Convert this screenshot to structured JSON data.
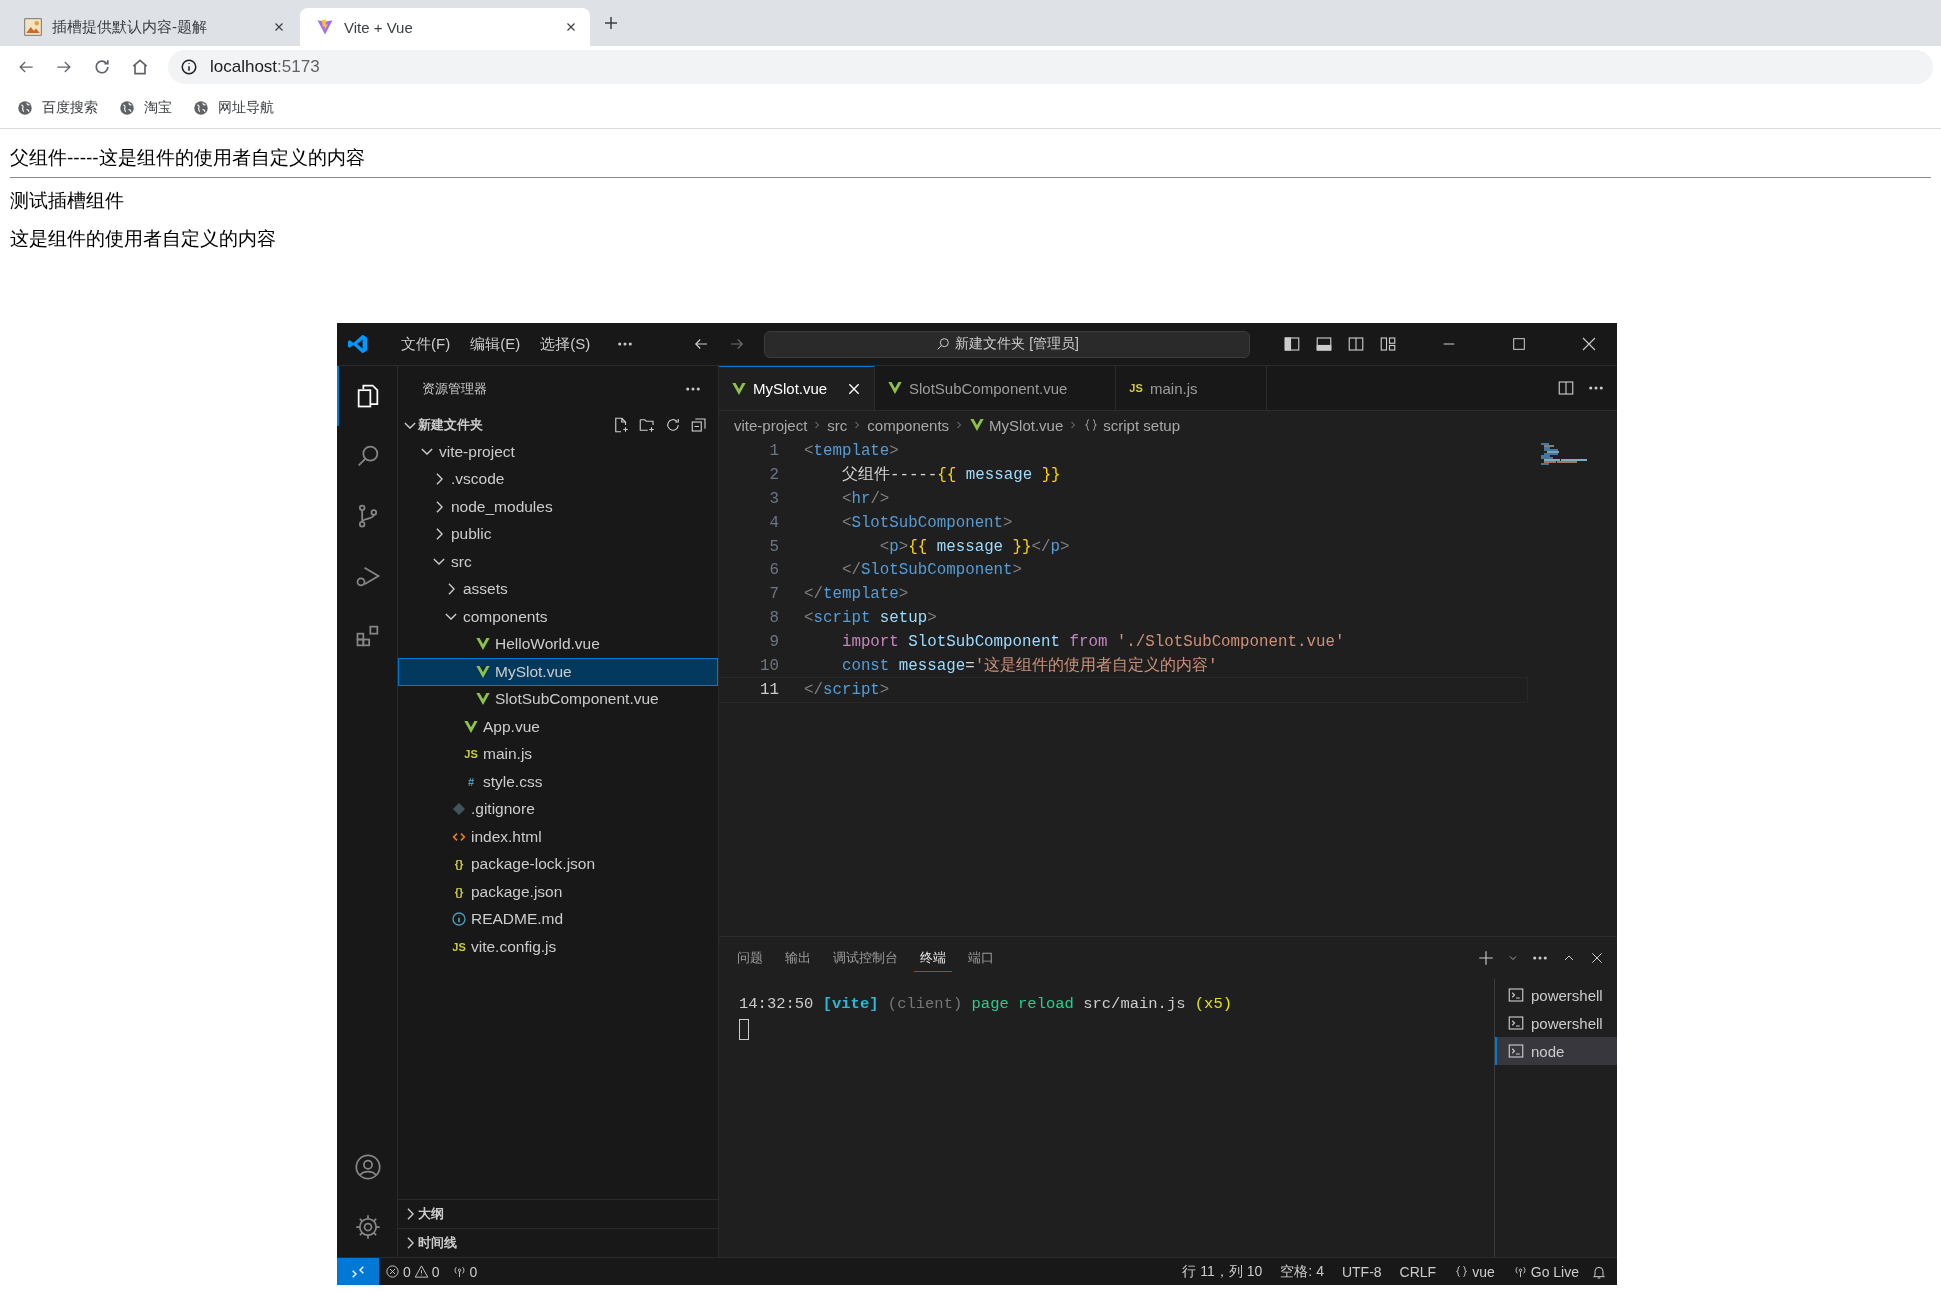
{
  "browser": {
    "tabs": [
      {
        "title": "插槽提供默认内容-题解",
        "selected": false
      },
      {
        "title": "Vite + Vue",
        "selected": true
      }
    ],
    "address": {
      "host": "localhost",
      "port": ":5173"
    },
    "bookmarks": [
      "百度搜索",
      "淘宝",
      "网址导航"
    ]
  },
  "page": {
    "lines": [
      {
        "kind": "text",
        "text": "父组件-----这是组件的使用者自定义的内容"
      },
      {
        "kind": "rule"
      },
      {
        "kind": "text",
        "text": "测试插槽组件"
      },
      {
        "kind": "text",
        "text": "这是组件的使用者自定义的内容"
      }
    ]
  },
  "vscode": {
    "menus": [
      "文件(F)",
      "编辑(E)",
      "选择(S)"
    ],
    "command_center": "新建文件夹 [管理员]",
    "activity": [
      {
        "kind": "explorer",
        "selected": true
      },
      {
        "kind": "search",
        "selected": false
      },
      {
        "kind": "scm",
        "selected": false
      },
      {
        "kind": "debug",
        "selected": false
      },
      {
        "kind": "extensions",
        "selected": false
      }
    ],
    "sidebar": {
      "title": "资源管理器",
      "root": {
        "label": "新建文件夹",
        "expanded": true
      },
      "tree": [
        {
          "label": "vite-project",
          "kind": "folder",
          "expanded": true,
          "selected": false,
          "children": [
            {
              "label": ".vscode",
              "kind": "folder",
              "expanded": false,
              "selected": false
            },
            {
              "label": "node_modules",
              "kind": "folder",
              "expanded": false,
              "selected": false
            },
            {
              "label": "public",
              "kind": "folder",
              "expanded": false,
              "selected": false
            },
            {
              "label": "src",
              "kind": "folder",
              "expanded": true,
              "selected": false,
              "children": [
                {
                  "label": "assets",
                  "kind": "folder",
                  "expanded": false,
                  "selected": false
                },
                {
                  "label": "components",
                  "kind": "folder",
                  "expanded": true,
                  "selected": false,
                  "children": [
                    {
                      "label": "HelloWorld.vue",
                      "kind": "vue",
                      "selected": false
                    },
                    {
                      "label": "MySlot.vue",
                      "kind": "vue",
                      "selected": true
                    },
                    {
                      "label": "SlotSubComponent.vue",
                      "kind": "vue",
                      "selected": false
                    }
                  ]
                },
                {
                  "label": "App.vue",
                  "kind": "vue",
                  "selected": false
                },
                {
                  "label": "main.js",
                  "kind": "js",
                  "glyph": "JS",
                  "selected": false
                },
                {
                  "label": "style.css",
                  "kind": "css",
                  "glyph": "#",
                  "selected": false
                }
              ]
            },
            {
              "label": ".gitignore",
              "kind": "git",
              "selected": false
            },
            {
              "label": "index.html",
              "kind": "html",
              "selected": false
            },
            {
              "label": "package-lock.json",
              "kind": "json",
              "glyph": "{}",
              "selected": false
            },
            {
              "label": "package.json",
              "kind": "json",
              "glyph": "{}",
              "selected": false
            },
            {
              "label": "README.md",
              "kind": "info",
              "selected": false
            },
            {
              "label": "vite.config.js",
              "kind": "js",
              "glyph": "JS",
              "selected": false
            }
          ]
        }
      ],
      "sections": [
        {
          "label": "大纲",
          "expanded": false
        },
        {
          "label": "时间线",
          "expanded": false
        }
      ]
    },
    "editor_tabs": [
      {
        "label": "MySlot.vue",
        "kind": "vue",
        "selected": true
      },
      {
        "label": "SlotSubComponent.vue",
        "kind": "vue",
        "selected": false
      },
      {
        "label": "main.js",
        "kind": "js",
        "glyph": "JS",
        "selected": false
      }
    ],
    "breadcrumbs": [
      {
        "label": "vite-project",
        "kind": "folder"
      },
      {
        "label": "src",
        "kind": "folder"
      },
      {
        "label": "components",
        "kind": "folder"
      },
      {
        "label": "MySlot.vue",
        "kind": "vue"
      },
      {
        "label": "script setup",
        "kind": "symbol"
      }
    ],
    "code": [
      {
        "number": "1",
        "current": false,
        "tokens": [
          {
            "kind": "punct",
            "text": "<"
          },
          {
            "kind": "tag",
            "text": "template"
          },
          {
            "kind": "punct",
            "text": ">"
          }
        ]
      },
      {
        "number": "2",
        "current": false,
        "tokens": [
          {
            "kind": "text",
            "text": "    父组件-----"
          },
          {
            "kind": "brace",
            "text": "{{"
          },
          {
            "kind": "var",
            "text": " message "
          },
          {
            "kind": "brace",
            "text": "}}"
          }
        ]
      },
      {
        "number": "3",
        "current": false,
        "tokens": [
          {
            "kind": "punct",
            "text": "    <"
          },
          {
            "kind": "tag",
            "text": "hr"
          },
          {
            "kind": "punct",
            "text": "/>"
          }
        ]
      },
      {
        "number": "4",
        "current": false,
        "tokens": [
          {
            "kind": "punct",
            "text": "    <"
          },
          {
            "kind": "tag",
            "text": "SlotSubComponent"
          },
          {
            "kind": "punct",
            "text": ">"
          }
        ]
      },
      {
        "number": "5",
        "current": false,
        "tokens": [
          {
            "kind": "punct",
            "text": "        <"
          },
          {
            "kind": "tag",
            "text": "p"
          },
          {
            "kind": "punct",
            "text": ">"
          },
          {
            "kind": "brace",
            "text": "{{"
          },
          {
            "kind": "var",
            "text": " message "
          },
          {
            "kind": "brace",
            "text": "}}"
          },
          {
            "kind": "punct",
            "text": "</"
          },
          {
            "kind": "tag",
            "text": "p"
          },
          {
            "kind": "punct",
            "text": ">"
          }
        ]
      },
      {
        "number": "6",
        "current": false,
        "tokens": [
          {
            "kind": "punct",
            "text": "    </"
          },
          {
            "kind": "tag",
            "text": "SlotSubComponent"
          },
          {
            "kind": "punct",
            "text": ">"
          }
        ]
      },
      {
        "number": "7",
        "current": false,
        "tokens": [
          {
            "kind": "punct",
            "text": "</"
          },
          {
            "kind": "tag",
            "text": "template"
          },
          {
            "kind": "punct",
            "text": ">"
          }
        ]
      },
      {
        "number": "8",
        "current": false,
        "tokens": [
          {
            "kind": "punct",
            "text": "<"
          },
          {
            "kind": "tag",
            "text": "script "
          },
          {
            "kind": "var",
            "text": "setup"
          },
          {
            "kind": "punct",
            "text": ">"
          }
        ]
      },
      {
        "number": "9",
        "current": false,
        "tokens": [
          {
            "kind": "control",
            "text": "    import "
          },
          {
            "kind": "var",
            "text": "SlotSubComponent "
          },
          {
            "kind": "control",
            "text": "from "
          },
          {
            "kind": "string",
            "text": "'./SlotSubComponent.vue'"
          }
        ]
      },
      {
        "number": "10",
        "current": false,
        "tokens": [
          {
            "kind": "keyword",
            "text": "    const "
          },
          {
            "kind": "var",
            "text": "message"
          },
          {
            "kind": "text",
            "text": "="
          },
          {
            "kind": "string",
            "text": "'这是组件的使用者自定义的内容'"
          }
        ]
      },
      {
        "number": "11",
        "current": true,
        "tokens": [
          {
            "kind": "punct",
            "text": "</"
          },
          {
            "kind": "tag",
            "text": "script"
          },
          {
            "kind": "punct",
            "text": ">"
          }
        ]
      }
    ],
    "panel": {
      "tabs": [
        {
          "label": "问题",
          "selected": false
        },
        {
          "label": "输出",
          "selected": false
        },
        {
          "label": "调试控制台",
          "selected": false
        },
        {
          "label": "终端",
          "selected": true
        },
        {
          "label": "端口",
          "selected": false
        }
      ],
      "terminal_lines": [
        [
          {
            "kind": "plain",
            "text": "14:32:50 "
          },
          {
            "kind": "tag",
            "text": "[vite]"
          },
          {
            "kind": "dim",
            "text": " (client)"
          },
          {
            "kind": "green",
            "text": " page reload"
          },
          {
            "kind": "plain",
            "text": " src/main.js"
          },
          {
            "kind": "yellow",
            "text": " (x5)"
          }
        ]
      ],
      "terminals": [
        {
          "name": "powershell",
          "selected": false
        },
        {
          "name": "powershell",
          "selected": false
        },
        {
          "name": "node",
          "selected": true
        }
      ]
    },
    "status_bar": {
      "errors": "0",
      "warnings": "0",
      "ports": "0",
      "right": [
        {
          "kind": "plain",
          "label": "行 11，列 10"
        },
        {
          "kind": "plain",
          "label": "空格: 4"
        },
        {
          "kind": "plain",
          "label": "UTF-8"
        },
        {
          "kind": "plain",
          "label": "CRLF"
        },
        {
          "kind": "braces",
          "label": "vue"
        },
        {
          "kind": "broadcast",
          "label": "Go Live"
        }
      ]
    }
  }
}
